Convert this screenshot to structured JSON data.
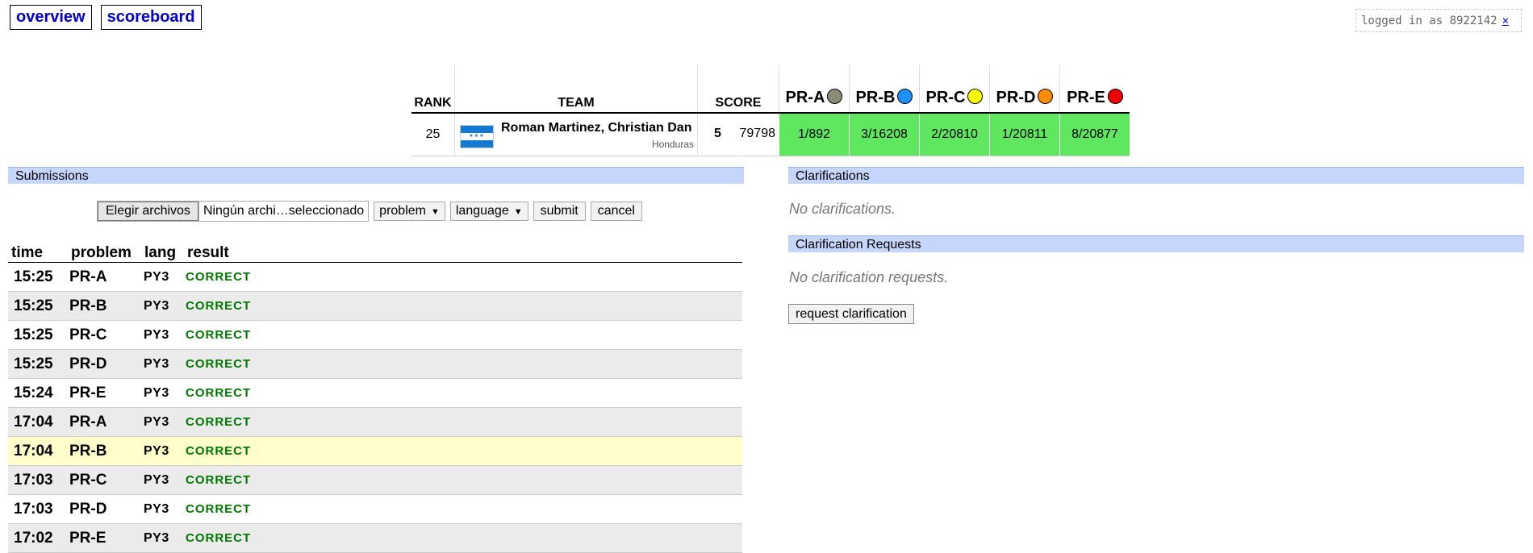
{
  "nav": {
    "overview": "overview",
    "scoreboard": "scoreboard"
  },
  "login": {
    "text": "logged in as 8922142",
    "logout": "×"
  },
  "scoreboard": {
    "headers": {
      "rank": "RANK",
      "team": "TEAM",
      "score": "SCORE"
    },
    "problems": [
      {
        "label": "PR-A",
        "color": "#8b8b77"
      },
      {
        "label": "PR-B",
        "color": "#1e90ff"
      },
      {
        "label": "PR-C",
        "color": "#ffff00"
      },
      {
        "label": "PR-D",
        "color": "#ff8c00"
      },
      {
        "label": "PR-E",
        "color": "#ee0000"
      }
    ],
    "row": {
      "rank": "25",
      "team": "Roman Martinez, Christian Dan",
      "affiliation": "Honduras",
      "solved": "5",
      "time": "79798",
      "cells": [
        "1/892",
        "3/16208",
        "2/20810",
        "1/20811",
        "8/20877"
      ]
    }
  },
  "submissions": {
    "title": "Submissions",
    "form": {
      "file_button": "Elegir archivos",
      "file_name": "Ningún archi…seleccionado",
      "problem_select": "problem",
      "language_select": "language",
      "submit": "submit",
      "cancel": "cancel"
    },
    "columns": {
      "time": "time",
      "problem": "problem",
      "lang": "lang",
      "result": "result"
    },
    "rows": [
      {
        "time": "15:25",
        "problem": "PR-A",
        "lang": "PY3",
        "result": "CORRECT"
      },
      {
        "time": "15:25",
        "problem": "PR-B",
        "lang": "PY3",
        "result": "CORRECT"
      },
      {
        "time": "15:25",
        "problem": "PR-C",
        "lang": "PY3",
        "result": "CORRECT"
      },
      {
        "time": "15:25",
        "problem": "PR-D",
        "lang": "PY3",
        "result": "CORRECT"
      },
      {
        "time": "15:24",
        "problem": "PR-E",
        "lang": "PY3",
        "result": "CORRECT"
      },
      {
        "time": "17:04",
        "problem": "PR-A",
        "lang": "PY3",
        "result": "CORRECT"
      },
      {
        "time": "17:04",
        "problem": "PR-B",
        "lang": "PY3",
        "result": "CORRECT"
      },
      {
        "time": "17:03",
        "problem": "PR-C",
        "lang": "PY3",
        "result": "CORRECT"
      },
      {
        "time": "17:03",
        "problem": "PR-D",
        "lang": "PY3",
        "result": "CORRECT"
      },
      {
        "time": "17:02",
        "problem": "PR-E",
        "lang": "PY3",
        "result": "CORRECT"
      }
    ]
  },
  "clarifications": {
    "title": "Clarifications",
    "empty": "No clarifications.",
    "requests_title": "Clarification Requests",
    "requests_empty": "No clarification requests.",
    "request_button": "request clarification"
  }
}
